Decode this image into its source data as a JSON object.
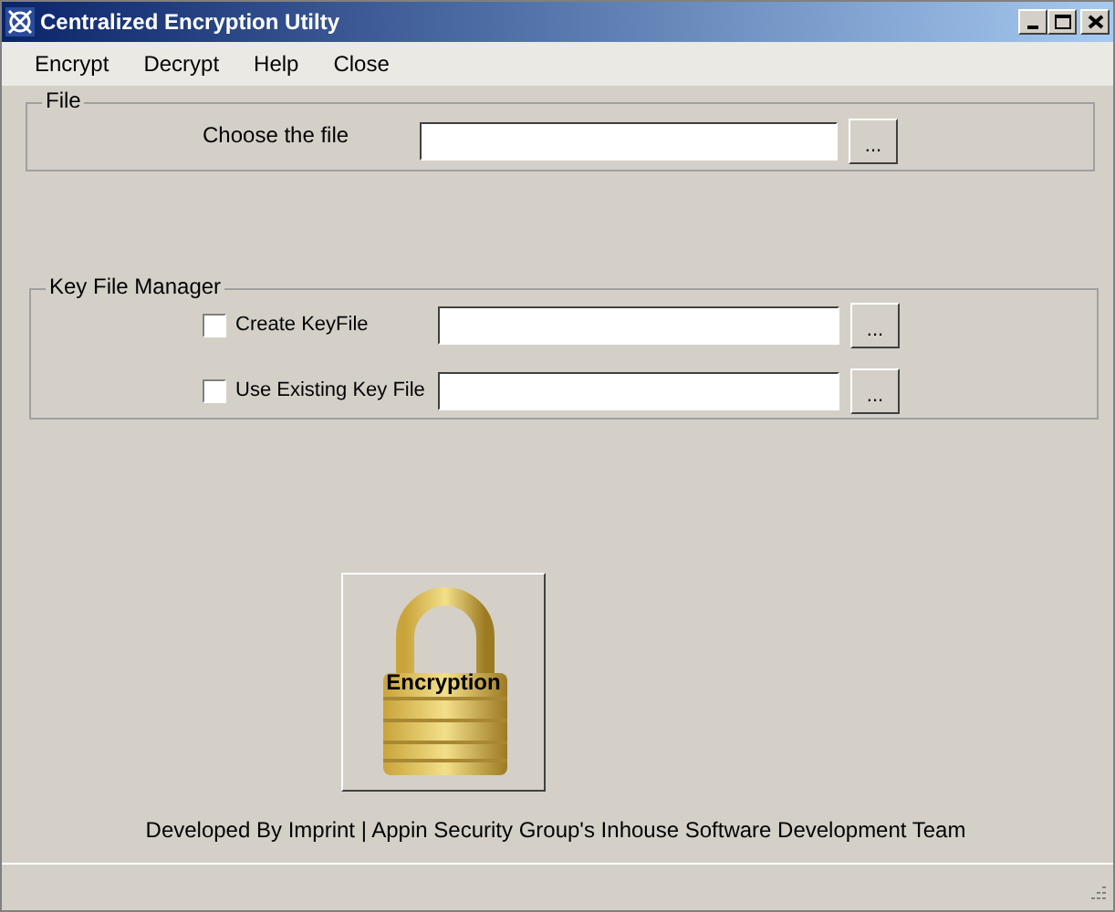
{
  "window": {
    "title": "Centralized Encryption Utilty"
  },
  "menu": [
    "Encrypt",
    "Decrypt",
    "Help",
    "Close"
  ],
  "file_group": {
    "title": "File",
    "label": "Choose the file",
    "browse": "..."
  },
  "key_group": {
    "title": "Key File Manager",
    "options": [
      {
        "label": "Create KeyFile",
        "checked": false,
        "browse": "..."
      },
      {
        "label": "Use Existing Key File",
        "checked": false,
        "browse": "..."
      }
    ]
  },
  "encrypt_button": {
    "label": "Encryption"
  },
  "footer": "Developed By Imprint | Appin Security Group's Inhouse Software Development Team"
}
